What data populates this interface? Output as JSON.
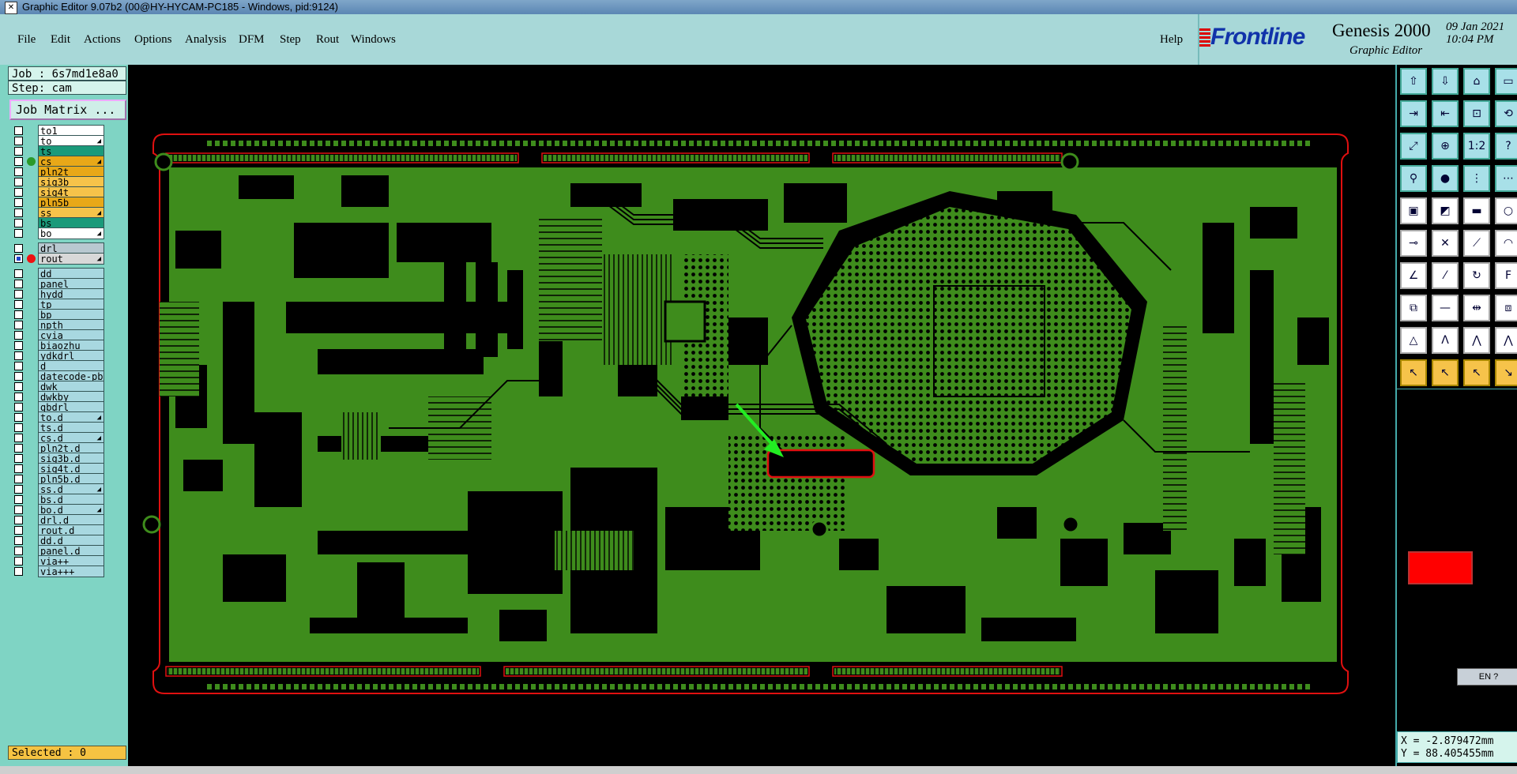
{
  "window": {
    "title": "Graphic Editor 9.07b2 (00@HY-HYCAM-PC185 - Windows, pid:9124)"
  },
  "menu": [
    "File",
    "Edit",
    "Actions",
    "Options",
    "Analysis",
    "DFM",
    "Step",
    "Rout",
    "Windows"
  ],
  "help_label": "Help",
  "brand": {
    "logo": "Frontline",
    "product": "Genesis 2000",
    "subtitle": "Graphic Editor",
    "date": "09 Jan 2021",
    "time": "10:04 PM"
  },
  "job": {
    "job_label": "Job : 6s7md1e8a0",
    "step_label": "Step: cam",
    "matrix_button": "Job Matrix ..."
  },
  "layers": [
    {
      "name": "to1",
      "color": "#ffffff"
    },
    {
      "name": "to",
      "color": "#ffffff",
      "arrow": true
    },
    {
      "name": "ts",
      "color": "#1a9a7a"
    },
    {
      "name": "cs",
      "color": "#e8a818",
      "arrow": true,
      "active": "#2a9a2a"
    },
    {
      "name": "pln2t",
      "color": "#e8a818"
    },
    {
      "name": "sig3b",
      "color": "#f6c34a"
    },
    {
      "name": "sig4t",
      "color": "#f6c34a"
    },
    {
      "name": "pln5b",
      "color": "#e8a818"
    },
    {
      "name": "ss",
      "color": "#f6c34a",
      "arrow": true
    },
    {
      "name": "bs",
      "color": "#1a9a7a"
    },
    {
      "name": "bo",
      "color": "#ffffff",
      "arrow": true
    },
    {
      "name": "drl",
      "color": "#b8c8d0",
      "gap": true
    },
    {
      "name": "rout",
      "color": "#d8d8d8",
      "active": "#ee1111",
      "arrow": true,
      "sq": true
    },
    {
      "name": "dd",
      "color": "#a8d8e0",
      "gap": true
    },
    {
      "name": "panel",
      "color": "#a8d8e0"
    },
    {
      "name": "hydd",
      "color": "#a8d8e0"
    },
    {
      "name": "tp",
      "color": "#a8d8e0"
    },
    {
      "name": "bp",
      "color": "#a8d8e0"
    },
    {
      "name": "npth",
      "color": "#a8d8e0"
    },
    {
      "name": "cvia",
      "color": "#a8d8e0"
    },
    {
      "name": "biaozhu",
      "color": "#a8d8e0"
    },
    {
      "name": "ydkdrl",
      "color": "#a8d8e0"
    },
    {
      "name": "d",
      "color": "#a8d8e0"
    },
    {
      "name": "datecode-pb",
      "color": "#a8d8e0"
    },
    {
      "name": "dwk",
      "color": "#a8d8e0"
    },
    {
      "name": "dwkby",
      "color": "#a8d8e0"
    },
    {
      "name": "gbdrl",
      "color": "#a8d8e0"
    },
    {
      "name": "to.d",
      "color": "#a8d8e0",
      "arrow": true
    },
    {
      "name": "ts.d",
      "color": "#a8d8e0"
    },
    {
      "name": "cs.d",
      "color": "#a8d8e0",
      "arrow": true
    },
    {
      "name": "pln2t.d",
      "color": "#a8d8e0"
    },
    {
      "name": "sig3b.d",
      "color": "#a8d8e0"
    },
    {
      "name": "sig4t.d",
      "color": "#a8d8e0"
    },
    {
      "name": "pln5b.d",
      "color": "#a8d8e0"
    },
    {
      "name": "ss.d",
      "color": "#a8d8e0",
      "arrow": true
    },
    {
      "name": "bs.d",
      "color": "#a8d8e0"
    },
    {
      "name": "bo.d",
      "color": "#a8d8e0",
      "arrow": true
    },
    {
      "name": "drl.d",
      "color": "#a8d8e0"
    },
    {
      "name": "rout.d",
      "color": "#a8d8e0"
    },
    {
      "name": "dd.d",
      "color": "#a8d8e0"
    },
    {
      "name": "panel.d",
      "color": "#a8d8e0"
    },
    {
      "name": "via++",
      "color": "#a8d8e0"
    },
    {
      "name": "via+++",
      "color": "#a8d8e0"
    }
  ],
  "selected_label": "Selected : 0",
  "coords": {
    "x": "X = -2.879472mm",
    "y": "Y = 88.405455mm"
  },
  "language_indicator": "EN",
  "toolbar_icons": [
    "layer-up-icon",
    "layer-down-icon",
    "home-icon",
    "window-icon",
    "zoom-in-icon",
    "zoom-out-icon",
    "pan-icon",
    "redraw-icon",
    "fit-icon",
    "zoom-window-icon",
    "scale-1-2-icon",
    "query-icon",
    "measure-icon",
    "snap-pad-icon",
    "route-icon",
    "net-icon",
    "add-pad-icon",
    "select-region-icon",
    "ruler-icon",
    "circle-icon",
    "connect-icon",
    "cross-icon",
    "segment-icon",
    "arc-icon",
    "line-icon",
    "diagonal-icon",
    "curve-icon",
    "text-f-icon",
    "copy-icon",
    "minus-icon",
    "align-icon",
    "group-icon",
    "polygon-icon",
    "angle-a-icon",
    "arc-a-icon",
    "arc-b-icon",
    "pointer-icon",
    "select-pointer-icon",
    "move-pointer-icon",
    "multi-pointer-icon"
  ],
  "colors": {
    "copper": "#3e8c1c",
    "outline": "#e01010",
    "highlight_arrow": "#22ee22"
  }
}
